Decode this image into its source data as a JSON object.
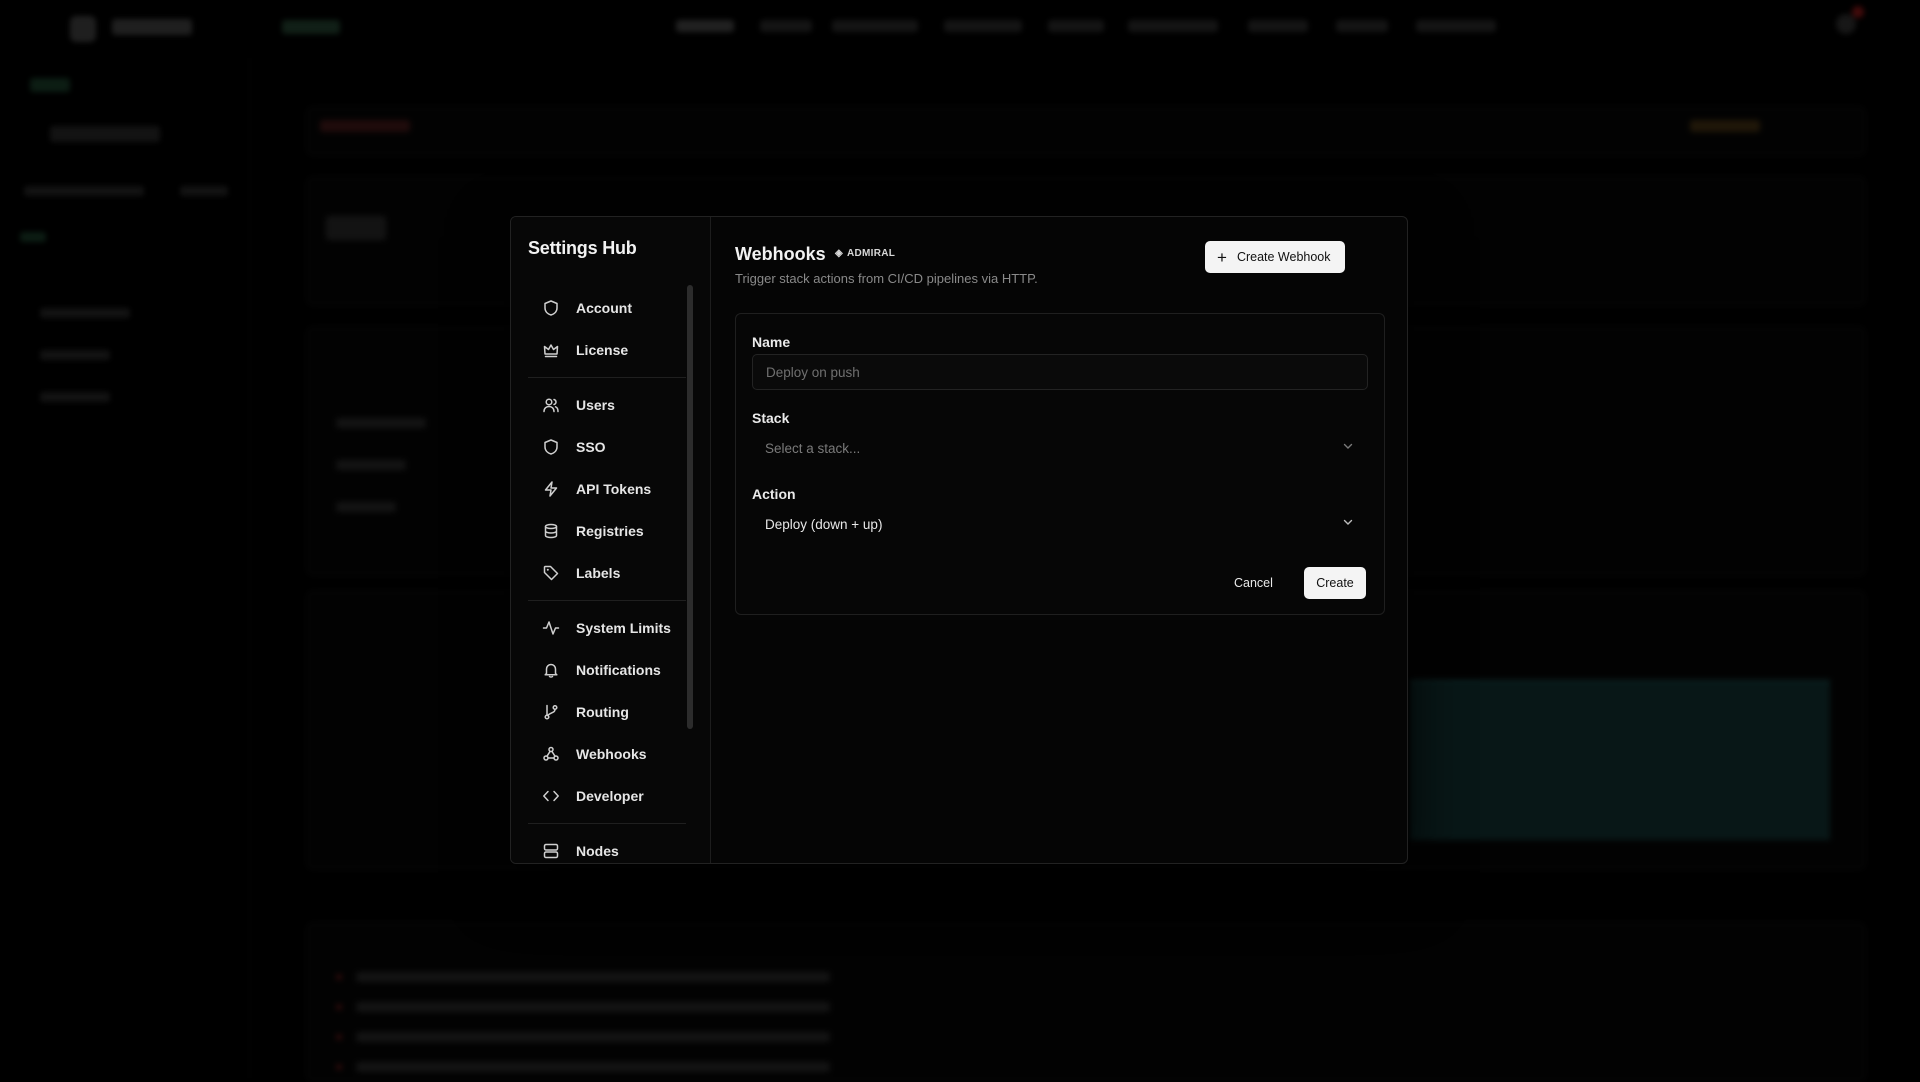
{
  "settings_hub": {
    "title": "Settings Hub",
    "groups": [
      [
        {
          "label": "Account",
          "icon": "shield-icon"
        },
        {
          "label": "License",
          "icon": "crown-icon"
        }
      ],
      [
        {
          "label": "Users",
          "icon": "users-icon"
        },
        {
          "label": "SSO",
          "icon": "shield-icon"
        },
        {
          "label": "API Tokens",
          "icon": "lightning-icon"
        },
        {
          "label": "Registries",
          "icon": "database-icon"
        },
        {
          "label": "Labels",
          "icon": "tag-icon"
        }
      ],
      [
        {
          "label": "System Limits",
          "icon": "activity-icon"
        },
        {
          "label": "Notifications",
          "icon": "bell-icon"
        },
        {
          "label": "Routing",
          "icon": "git-branch-icon"
        },
        {
          "label": "Webhooks",
          "icon": "webhook-icon"
        },
        {
          "label": "Developer",
          "icon": "code-icon"
        }
      ],
      [
        {
          "label": "Nodes",
          "icon": "server-icon"
        }
      ]
    ]
  },
  "webhooks": {
    "title": "Webhooks",
    "badge": "ADMIRAL",
    "subtitle": "Trigger stack actions from CI/CD pipelines via HTTP.",
    "create_button": "Create Webhook",
    "close_icon": "close-icon"
  },
  "form": {
    "name_label": "Name",
    "name_placeholder": "Deploy on push",
    "stack_label": "Stack",
    "stack_placeholder": "Select a stack...",
    "action_label": "Action",
    "action_value": "Deploy (down + up)",
    "cancel_label": "Cancel",
    "submit_label": "Create"
  },
  "colors": {
    "overlay": "#000000",
    "surface": "#050505",
    "border": "#222222",
    "primary_button": "#f4f4f4",
    "muted_text": "#8a8a8a"
  }
}
